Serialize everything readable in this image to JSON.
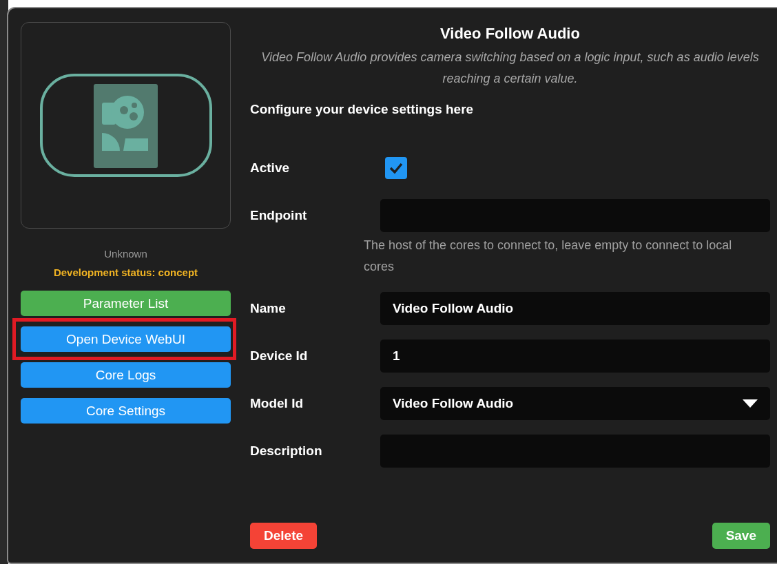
{
  "device": {
    "status": "Unknown",
    "development_status": "Development status: concept"
  },
  "side_buttons": [
    {
      "label": "Parameter List",
      "kind": "green",
      "highlighted": false
    },
    {
      "label": "Open Device WebUI",
      "kind": "blue",
      "highlighted": true
    },
    {
      "label": "Core Logs",
      "kind": "blue",
      "highlighted": false
    },
    {
      "label": "Core Settings",
      "kind": "blue",
      "highlighted": false
    }
  ],
  "title": "Video Follow Audio",
  "description": "Video Follow Audio provides camera switching based on a logic input, such as audio levels reaching a certain value.",
  "section_label": "Configure your device settings here",
  "fields": [
    {
      "label": "Active",
      "kind": "checkbox",
      "checked": true
    },
    {
      "label": "Endpoint",
      "kind": "text",
      "help": "The host of the cores to connect to, leave empty to connect to local cores"
    },
    {
      "label": "Name",
      "kind": "text",
      "value": "Video Follow Audio"
    },
    {
      "label": "Device Id",
      "kind": "text",
      "value": "1"
    },
    {
      "label": "Model Id",
      "kind": "select",
      "value": "Video Follow Audio"
    },
    {
      "label": "Description",
      "kind": "text"
    }
  ],
  "actions": {
    "delete": "Delete",
    "save": "Save"
  }
}
